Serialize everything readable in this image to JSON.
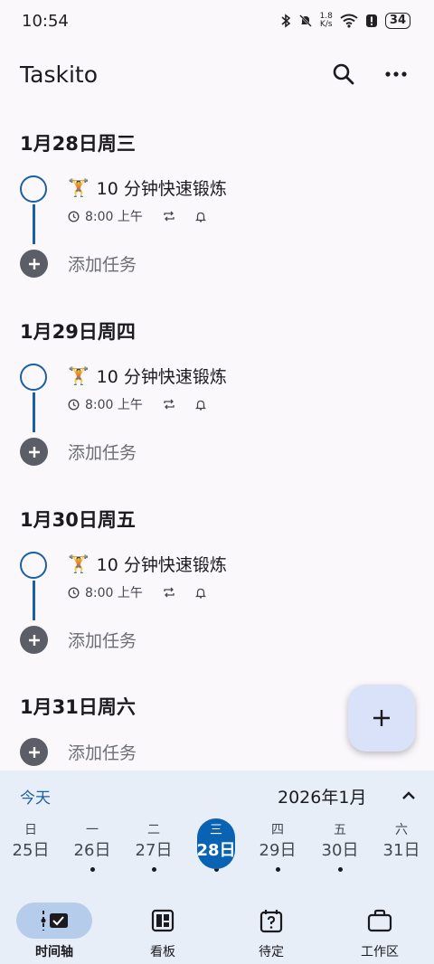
{
  "status_bar": {
    "time": "10:54",
    "speed_value": "1.8",
    "speed_unit": "K/s",
    "battery": "34"
  },
  "app_bar": {
    "title": "Taskito",
    "search_icon": "search-icon",
    "more_icon": "more-vert-icon"
  },
  "days": [
    {
      "header": "1月28日周三",
      "task_emoji": "🏋",
      "task_title": "10 分钟快速锻炼",
      "task_time": "8:00 上午",
      "add_label": "添加任务"
    },
    {
      "header": "1月29日周四",
      "task_emoji": "🏋",
      "task_title": "10 分钟快速锻炼",
      "task_time": "8:00 上午",
      "add_label": "添加任务"
    },
    {
      "header": "1月30日周五",
      "task_emoji": "🏋",
      "task_title": "10 分钟快速锻炼",
      "task_time": "8:00 上午",
      "add_label": "添加任务"
    },
    {
      "header": "1月31日周六",
      "add_label": "添加任务"
    }
  ],
  "calendar": {
    "today_label": "今天",
    "month_label": "2026年1月",
    "week": [
      {
        "weekday": "日",
        "date": "25日",
        "has_task": false
      },
      {
        "weekday": "一",
        "date": "26日",
        "has_task": true
      },
      {
        "weekday": "二",
        "date": "27日",
        "has_task": true
      },
      {
        "weekday": "三",
        "date": "28日",
        "has_task": true,
        "selected": true
      },
      {
        "weekday": "四",
        "date": "29日",
        "has_task": true
      },
      {
        "weekday": "五",
        "date": "30日",
        "has_task": true
      },
      {
        "weekday": "六",
        "date": "31日",
        "has_task": false
      }
    ],
    "accent_color": "#0a62b3"
  },
  "bottom_nav": [
    {
      "label": "时间轴",
      "icon": "timeline-icon",
      "active": true
    },
    {
      "label": "看板",
      "icon": "board-icon",
      "active": false
    },
    {
      "label": "待定",
      "icon": "pending-calendar-icon",
      "active": false
    },
    {
      "label": "工作区",
      "icon": "briefcase-icon",
      "active": false
    }
  ]
}
